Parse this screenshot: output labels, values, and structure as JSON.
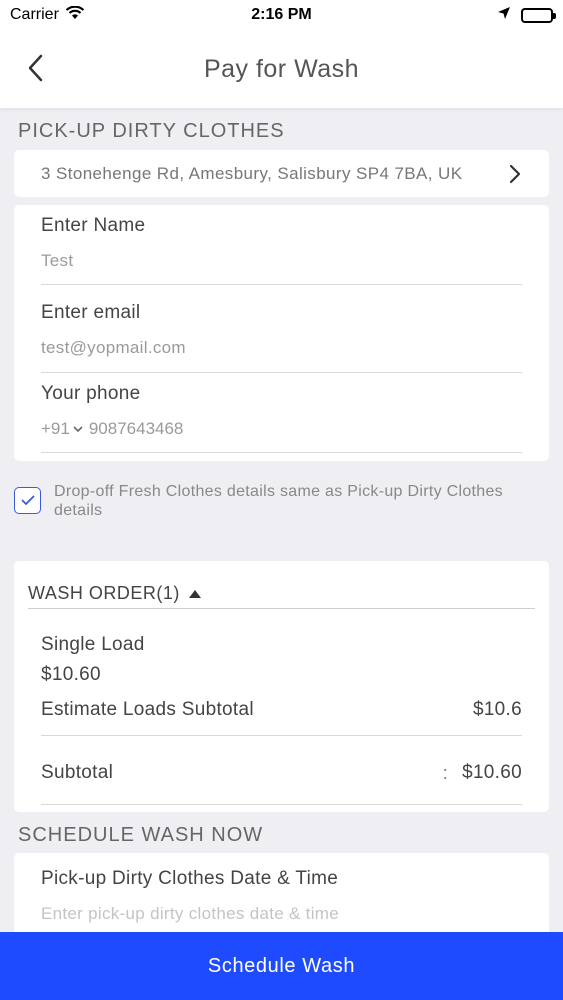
{
  "status_bar": {
    "carrier": "Carrier",
    "time": "2:16 PM"
  },
  "nav": {
    "title": "Pay for Wash"
  },
  "pickup": {
    "section_title": "PICK-UP DIRTY CLOTHES",
    "address": "3 Stonehenge Rd, Amesbury, Salisbury SP4 7BA, UK"
  },
  "contact": {
    "name_label": "Enter Name",
    "name_value": "Test",
    "email_label": "Enter email",
    "email_value": "test@yopmail.com",
    "phone_label": "Your phone",
    "country_code": "+91",
    "phone_value": "9087643468"
  },
  "same_details": {
    "checked": true,
    "text": "Drop-off Fresh Clothes details same as Pick-up Dirty Clothes details"
  },
  "wash_order": {
    "title": "WASH ORDER(1)",
    "item_name": "Single Load",
    "item_price": "$10.60",
    "estimate_label": "Estimate Loads Subtotal",
    "estimate_value": "$10.6",
    "subtotal_label": "Subtotal",
    "subtotal_colon": ":",
    "subtotal_value": "$10.60"
  },
  "schedule": {
    "section_title": "SCHEDULE WASH NOW",
    "pickup_label": "Pick-up Dirty Clothes Date & Time",
    "pickup_placeholder": "Enter pick-up dirty clothes date & time"
  },
  "action": {
    "schedule_label": "Schedule Wash"
  },
  "colors": {
    "accent": "#1f4bff",
    "checkbox": "#3a5bd9",
    "background": "#efeff3"
  }
}
